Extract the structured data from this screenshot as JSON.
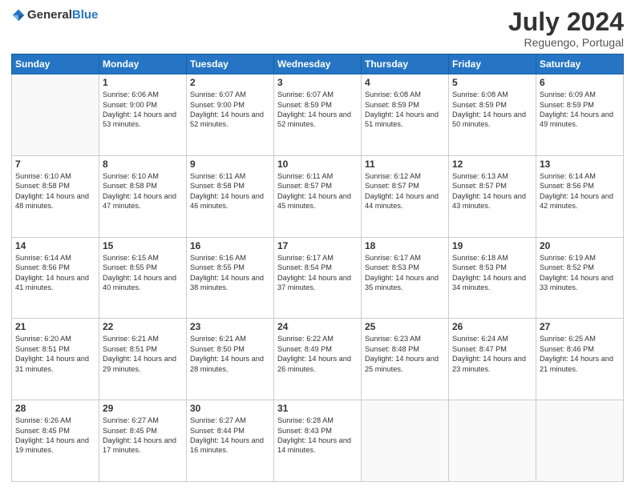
{
  "logo": {
    "text_general": "General",
    "text_blue": "Blue"
  },
  "header": {
    "month_year": "July 2024",
    "location": "Reguengo, Portugal"
  },
  "days_of_week": [
    "Sunday",
    "Monday",
    "Tuesday",
    "Wednesday",
    "Thursday",
    "Friday",
    "Saturday"
  ],
  "weeks": [
    [
      {
        "day": "",
        "sunrise": "",
        "sunset": "",
        "daylight": ""
      },
      {
        "day": "1",
        "sunrise": "Sunrise: 6:06 AM",
        "sunset": "Sunset: 9:00 PM",
        "daylight": "Daylight: 14 hours and 53 minutes."
      },
      {
        "day": "2",
        "sunrise": "Sunrise: 6:07 AM",
        "sunset": "Sunset: 9:00 PM",
        "daylight": "Daylight: 14 hours and 52 minutes."
      },
      {
        "day": "3",
        "sunrise": "Sunrise: 6:07 AM",
        "sunset": "Sunset: 8:59 PM",
        "daylight": "Daylight: 14 hours and 52 minutes."
      },
      {
        "day": "4",
        "sunrise": "Sunrise: 6:08 AM",
        "sunset": "Sunset: 8:59 PM",
        "daylight": "Daylight: 14 hours and 51 minutes."
      },
      {
        "day": "5",
        "sunrise": "Sunrise: 6:08 AM",
        "sunset": "Sunset: 8:59 PM",
        "daylight": "Daylight: 14 hours and 50 minutes."
      },
      {
        "day": "6",
        "sunrise": "Sunrise: 6:09 AM",
        "sunset": "Sunset: 8:59 PM",
        "daylight": "Daylight: 14 hours and 49 minutes."
      }
    ],
    [
      {
        "day": "7",
        "sunrise": "Sunrise: 6:10 AM",
        "sunset": "Sunset: 8:58 PM",
        "daylight": "Daylight: 14 hours and 48 minutes."
      },
      {
        "day": "8",
        "sunrise": "Sunrise: 6:10 AM",
        "sunset": "Sunset: 8:58 PM",
        "daylight": "Daylight: 14 hours and 47 minutes."
      },
      {
        "day": "9",
        "sunrise": "Sunrise: 6:11 AM",
        "sunset": "Sunset: 8:58 PM",
        "daylight": "Daylight: 14 hours and 46 minutes."
      },
      {
        "day": "10",
        "sunrise": "Sunrise: 6:11 AM",
        "sunset": "Sunset: 8:57 PM",
        "daylight": "Daylight: 14 hours and 45 minutes."
      },
      {
        "day": "11",
        "sunrise": "Sunrise: 6:12 AM",
        "sunset": "Sunset: 8:57 PM",
        "daylight": "Daylight: 14 hours and 44 minutes."
      },
      {
        "day": "12",
        "sunrise": "Sunrise: 6:13 AM",
        "sunset": "Sunset: 8:57 PM",
        "daylight": "Daylight: 14 hours and 43 minutes."
      },
      {
        "day": "13",
        "sunrise": "Sunrise: 6:14 AM",
        "sunset": "Sunset: 8:56 PM",
        "daylight": "Daylight: 14 hours and 42 minutes."
      }
    ],
    [
      {
        "day": "14",
        "sunrise": "Sunrise: 6:14 AM",
        "sunset": "Sunset: 8:56 PM",
        "daylight": "Daylight: 14 hours and 41 minutes."
      },
      {
        "day": "15",
        "sunrise": "Sunrise: 6:15 AM",
        "sunset": "Sunset: 8:55 PM",
        "daylight": "Daylight: 14 hours and 40 minutes."
      },
      {
        "day": "16",
        "sunrise": "Sunrise: 6:16 AM",
        "sunset": "Sunset: 8:55 PM",
        "daylight": "Daylight: 14 hours and 38 minutes."
      },
      {
        "day": "17",
        "sunrise": "Sunrise: 6:17 AM",
        "sunset": "Sunset: 8:54 PM",
        "daylight": "Daylight: 14 hours and 37 minutes."
      },
      {
        "day": "18",
        "sunrise": "Sunrise: 6:17 AM",
        "sunset": "Sunset: 8:53 PM",
        "daylight": "Daylight: 14 hours and 35 minutes."
      },
      {
        "day": "19",
        "sunrise": "Sunrise: 6:18 AM",
        "sunset": "Sunset: 8:53 PM",
        "daylight": "Daylight: 14 hours and 34 minutes."
      },
      {
        "day": "20",
        "sunrise": "Sunrise: 6:19 AM",
        "sunset": "Sunset: 8:52 PM",
        "daylight": "Daylight: 14 hours and 33 minutes."
      }
    ],
    [
      {
        "day": "21",
        "sunrise": "Sunrise: 6:20 AM",
        "sunset": "Sunset: 8:51 PM",
        "daylight": "Daylight: 14 hours and 31 minutes."
      },
      {
        "day": "22",
        "sunrise": "Sunrise: 6:21 AM",
        "sunset": "Sunset: 8:51 PM",
        "daylight": "Daylight: 14 hours and 29 minutes."
      },
      {
        "day": "23",
        "sunrise": "Sunrise: 6:21 AM",
        "sunset": "Sunset: 8:50 PM",
        "daylight": "Daylight: 14 hours and 28 minutes."
      },
      {
        "day": "24",
        "sunrise": "Sunrise: 6:22 AM",
        "sunset": "Sunset: 8:49 PM",
        "daylight": "Daylight: 14 hours and 26 minutes."
      },
      {
        "day": "25",
        "sunrise": "Sunrise: 6:23 AM",
        "sunset": "Sunset: 8:48 PM",
        "daylight": "Daylight: 14 hours and 25 minutes."
      },
      {
        "day": "26",
        "sunrise": "Sunrise: 6:24 AM",
        "sunset": "Sunset: 8:47 PM",
        "daylight": "Daylight: 14 hours and 23 minutes."
      },
      {
        "day": "27",
        "sunrise": "Sunrise: 6:25 AM",
        "sunset": "Sunset: 8:46 PM",
        "daylight": "Daylight: 14 hours and 21 minutes."
      }
    ],
    [
      {
        "day": "28",
        "sunrise": "Sunrise: 6:26 AM",
        "sunset": "Sunset: 8:45 PM",
        "daylight": "Daylight: 14 hours and 19 minutes."
      },
      {
        "day": "29",
        "sunrise": "Sunrise: 6:27 AM",
        "sunset": "Sunset: 8:45 PM",
        "daylight": "Daylight: 14 hours and 17 minutes."
      },
      {
        "day": "30",
        "sunrise": "Sunrise: 6:27 AM",
        "sunset": "Sunset: 8:44 PM",
        "daylight": "Daylight: 14 hours and 16 minutes."
      },
      {
        "day": "31",
        "sunrise": "Sunrise: 6:28 AM",
        "sunset": "Sunset: 8:43 PM",
        "daylight": "Daylight: 14 hours and 14 minutes."
      },
      {
        "day": "",
        "sunrise": "",
        "sunset": "",
        "daylight": ""
      },
      {
        "day": "",
        "sunrise": "",
        "sunset": "",
        "daylight": ""
      },
      {
        "day": "",
        "sunrise": "",
        "sunset": "",
        "daylight": ""
      }
    ]
  ]
}
